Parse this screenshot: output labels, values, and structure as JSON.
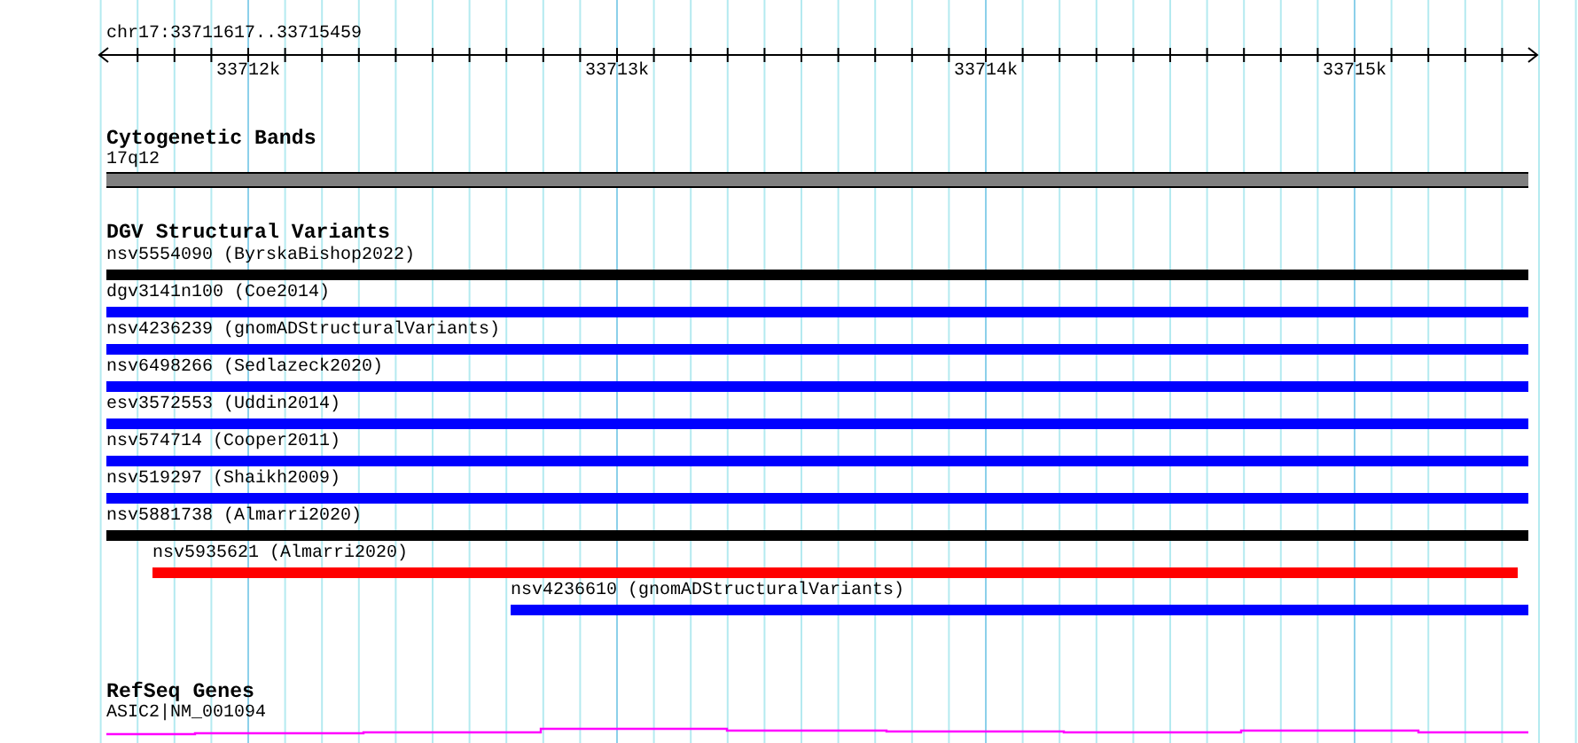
{
  "ruler": {
    "location": "chr17:33711617..33715459",
    "ticks": [
      "33712k",
      "33713k",
      "33714k",
      "33715k"
    ]
  },
  "tracks": [
    {
      "title": "Cytogenetic Bands",
      "kind": "band",
      "features": [
        {
          "label": "17q12",
          "color": "#808080"
        }
      ]
    },
    {
      "title": "DGV Structural Variants",
      "kind": "variant",
      "features": [
        {
          "label": "nsv5554090 (ByrskaBishop2022)",
          "color": "#000000"
        },
        {
          "label": "dgv3141n100 (Coe2014)",
          "color": "#0000ff"
        },
        {
          "label": "nsv4236239 (gnomADStructuralVariants)",
          "color": "#0000ff"
        },
        {
          "label": "nsv6498266 (Sedlazeck2020)",
          "color": "#0000ff"
        },
        {
          "label": "esv3572553 (Uddin2014)",
          "color": "#0000ff"
        },
        {
          "label": "nsv574714 (Cooper2011)",
          "color": "#0000ff"
        },
        {
          "label": "nsv519297 (Shaikh2009)",
          "color": "#0000ff"
        },
        {
          "label": "nsv5881738 (Almarri2020)",
          "color": "#000000"
        },
        {
          "label": "nsv5935621 (Almarri2020)",
          "color": "#ff0000"
        },
        {
          "label": "nsv4236610 (gnomADStructuralVariants)",
          "color": "#0000ff"
        }
      ]
    },
    {
      "title": "RefSeq Genes",
      "kind": "gene",
      "features": [
        {
          "label": "ASIC2|NM_001094",
          "color": "#ff00ff"
        }
      ]
    }
  ]
}
